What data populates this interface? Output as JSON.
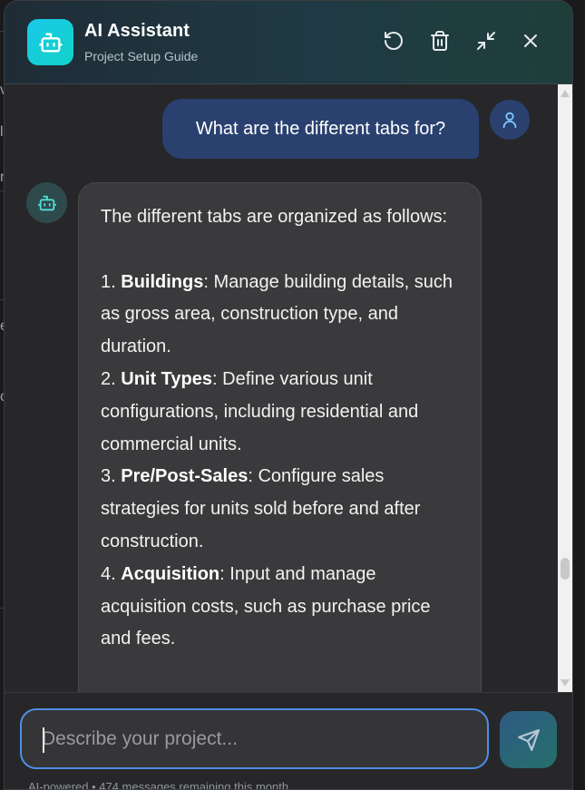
{
  "header": {
    "title": "AI Assistant",
    "subtitle": "Project Setup Guide",
    "icons": [
      "reset-icon",
      "trash-icon",
      "minimize-icon",
      "close-icon"
    ]
  },
  "messages": {
    "user": {
      "text": "What are the different tabs for?"
    },
    "bot": {
      "intro": "The different tabs are organized as follows:",
      "items": [
        {
          "number": "1.",
          "name": "Buildings",
          "sep": ":",
          "desc": " Manage building details, such as gross area, construction type, and duration."
        },
        {
          "number": "2.",
          "name": "Unit Types",
          "sep": ":",
          "desc": " Define various unit configurations, including residential and commercial units."
        },
        {
          "number": "3.",
          "name": "Pre/Post-Sales",
          "sep": ":",
          "desc": " Configure sales strategies for units sold before and after construction."
        },
        {
          "number": "4.",
          "name": "Acquisition",
          "sep": ":",
          "desc": " Input and manage acquisition costs, such as purchase price and fees."
        }
      ]
    }
  },
  "composer": {
    "placeholder": "Describe your project...",
    "value": "",
    "footer": "AI-powered • 474 messages remaining this month"
  },
  "colors": {
    "accent": "#4d8fe6",
    "logo": "#19c8e8",
    "user_bubble": "#2a4170",
    "bot_bubble": "#3a3a3c"
  }
}
